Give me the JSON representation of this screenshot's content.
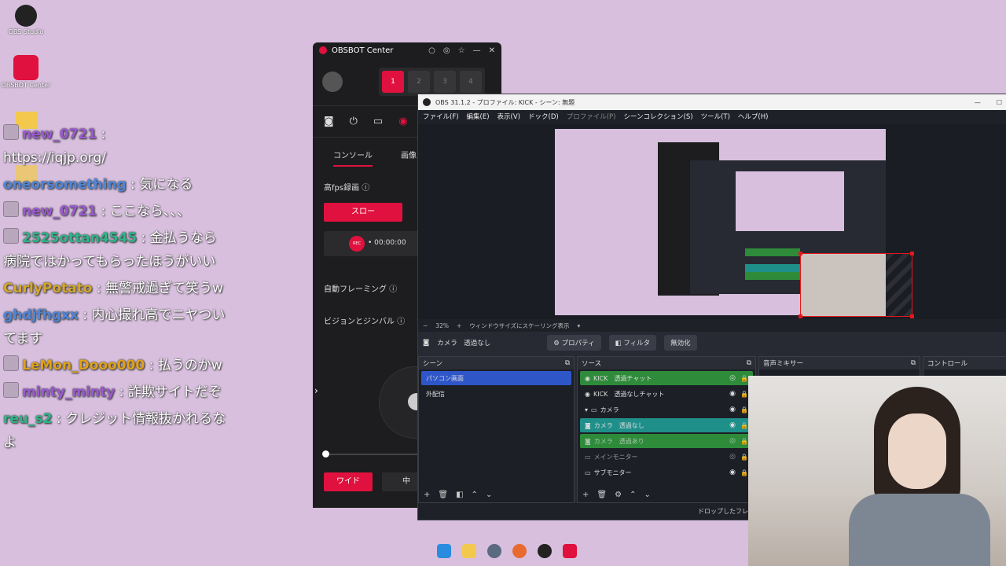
{
  "desktop": {
    "icons": [
      {
        "label": "OBS Studio",
        "icon": "obs-studio-icon"
      },
      {
        "label": "OBSBOT Center",
        "icon": "obsbot-icon"
      }
    ]
  },
  "chat": [
    {
      "name": "new_0721",
      "sep": " : ",
      "text": "https://iqjp.org/",
      "color": "#9b59d0"
    },
    {
      "name": "oneorsomething",
      "sep": " : ",
      "text": "気になる",
      "color": "#4f86d9"
    },
    {
      "name": "new_0721",
      "sep": " : ",
      "text": "ここなら、、、",
      "color": "#9b59d0"
    },
    {
      "name": "2525ottan4545",
      "sep": " : ",
      "text": "金払うなら病院ではかってもらったほうがいい",
      "color": "#2fb58a"
    },
    {
      "name": "CurlyPotato",
      "sep": " : ",
      "text": "無警戒過ぎて笑うw",
      "color": "#d4a72c"
    },
    {
      "name": "ghdjfhgxx",
      "sep": " : ",
      "text": "内心撮れ高でニヤついてます",
      "color": "#4f86d9"
    },
    {
      "name": "LeMon_Dooo000",
      "sep": " : ",
      "text": "払うのかw",
      "color": "#e0a21a"
    },
    {
      "name": "minty_minty",
      "sep": " : ",
      "text": "詐欺サイトだぞ",
      "color": "#9b59d0"
    },
    {
      "name": "reu_s2",
      "sep": " : ",
      "text": "クレジット情報抜かれるなよ",
      "color": "#2fb58a"
    }
  ],
  "obsbot": {
    "title": "OBSBOT Center",
    "slots": [
      "1",
      "2",
      "3",
      "4"
    ],
    "tabs": [
      "コンソール",
      "画像"
    ],
    "high_fps_label": "高fps録画",
    "slow_label": "スロー",
    "rec_label": "REC",
    "timer": "• 00:00:00",
    "auto_framing": "自動フレーミング",
    "vision_gimbal": "ビジョンとジンバル",
    "wide_label": "ワイド",
    "mid_label": "中"
  },
  "obs": {
    "title": "OBS 31.1.2 - プロファイル: KICK - シーン: 無題",
    "menus": [
      "ファイル(F)",
      "編集(E)",
      "表示(V)",
      "ドック(D)",
      "プロファイル(P)",
      "シーンコレクション(S)",
      "ツール(T)",
      "ヘルプ(H)"
    ],
    "zoom": "32%",
    "scale_mode": "ウィンドウサイズにスケーリング表示",
    "selected_source": "カメラ　透過なし",
    "properties": "プロパティ",
    "filters": "フィルタ",
    "disable": "無効化",
    "scenes_header": "シーン",
    "scenes": [
      "パソコン画面",
      "外配信"
    ],
    "sources_header": "ソース",
    "sources": [
      {
        "label": "KICK　透過チャット",
        "bg": "#2e8b3a"
      },
      {
        "label": "KICK　透過なしチャット",
        "bg": ""
      },
      {
        "label": "カメラ",
        "bg": ""
      },
      {
        "label": "カメラ　透過なし",
        "bg": "#1f8f8a"
      },
      {
        "label": "カメラ　透過あり",
        "bg": "#2e8b3a"
      },
      {
        "label": "メインモニター",
        "bg": ""
      },
      {
        "label": "サブモニター",
        "bg": ""
      }
    ],
    "mixer_header": "音声ミキサー",
    "controls_header": "コントロール",
    "drop_frames": "ドロップしたフレーム"
  }
}
